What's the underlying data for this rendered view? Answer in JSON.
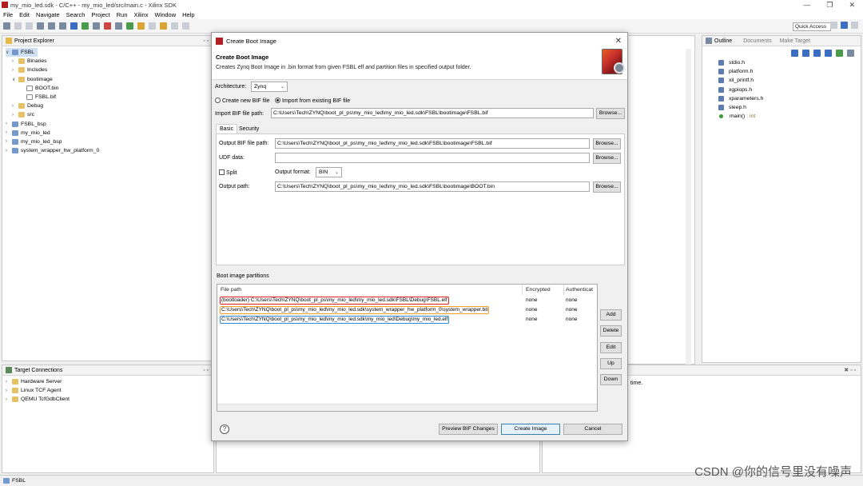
{
  "window": {
    "title": "my_mio_led.sdk - C/C++ - my_mio_led/src/main.c - Xilinx SDK"
  },
  "menu": [
    "File",
    "Edit",
    "Navigate",
    "Search",
    "Project",
    "Run",
    "Xilinx",
    "Window",
    "Help"
  ],
  "toolbar": {
    "quick_access": "Quick Access"
  },
  "project_explorer": {
    "title": "Project Explorer",
    "alt_tab": "",
    "items": [
      {
        "label": "FSBL"
      },
      {
        "label": "Binaries"
      },
      {
        "label": "Includes"
      },
      {
        "label": "bootimage"
      },
      {
        "label": "BOOT.bin"
      },
      {
        "label": "FSBL.bif"
      },
      {
        "label": "Debug"
      },
      {
        "label": "src"
      },
      {
        "label": "FSBL_bsp"
      },
      {
        "label": "my_mio_led"
      },
      {
        "label": "my_mio_led_bsp"
      },
      {
        "label": "system_wrapper_hw_platform_0"
      }
    ]
  },
  "target_connections": {
    "title": "Target Connections",
    "items": [
      {
        "label": "Hardware Server"
      },
      {
        "label": "Linux TCF Agent"
      },
      {
        "label": "QEMU TcfGdbClient"
      }
    ]
  },
  "outline": {
    "tabs": [
      "Outline",
      "Documents",
      "Make Target"
    ],
    "items": [
      "stdio.h",
      "platform.h",
      "xil_printf.h",
      "xgpiops.h",
      "xparameters.h",
      "sleep.h"
    ],
    "main_fn": "main()",
    "main_type": ": int"
  },
  "console_fragment": "time.",
  "status_bar": "FSBL",
  "watermark": "CSDN @你的信号里没有噪声",
  "dialog": {
    "window_title": "Create Boot Image",
    "header_title": "Create Boot Image",
    "header_desc": "Creates Zynq Boot Image in .bin format from given FSBL elf and partition files in specified output folder.",
    "architecture_label": "Architecture:",
    "architecture_value": "Zynq",
    "radio_new": "Create new BIF file",
    "radio_import": "Import from existing BIF file",
    "import_label": "Import BIF file path:",
    "import_value": "C:\\Users\\Tech\\ZYNQ\\boot_pl_ps\\my_mio_led\\my_mio_led.sdk\\FSBL\\bootimage\\FSBL.bif",
    "browse": "Browse...",
    "tab_basic": "Basic",
    "tab_security": "Security",
    "output_bif_label": "Output BIF file path:",
    "output_bif_value": "C:\\Users\\Tech\\ZYNQ\\boot_pl_ps\\my_mio_led\\my_mio_led.sdk\\FSBL\\bootimage\\FSBL.bif",
    "udf_label": "UDF data:",
    "udf_value": "",
    "split_label": "Split",
    "output_format_label": "Output format:",
    "output_format_value": "BIN",
    "output_path_label": "Output path:",
    "output_path_value": "C:\\Users\\Tech\\ZYNQ\\boot_pl_ps\\my_mio_led\\my_mio_led.sdk\\FSBL\\bootimage\\BOOT.bin",
    "partitions_label": "Boot image partitions",
    "columns": [
      "File path",
      "Encrypted",
      "Authenticat"
    ],
    "partitions": [
      {
        "path": "(bootloader) C:\\Users\\Tech\\ZYNQ\\boot_pl_ps\\my_mio_led\\my_mio_led.sdk\\FSBL\\Debug\\FSBL.elf",
        "encrypted": "none",
        "auth": "none",
        "color": "#e02020"
      },
      {
        "path": "C:\\Users\\Tech\\ZYNQ\\boot_pl_ps\\my_mio_led\\my_mio_led.sdk\\system_wrapper_hw_platform_0\\system_wrapper.bit",
        "encrypted": "none",
        "auth": "none",
        "color": "#f0a020"
      },
      {
        "path": "C:\\Users\\Tech\\ZYNQ\\boot_pl_ps\\my_mio_led\\my_mio_led.sdk\\my_mio_led\\Debug\\my_mio_led.elf",
        "encrypted": "none",
        "auth": "none",
        "color": "#2a8fd8"
      }
    ],
    "side_buttons": [
      "Add",
      "Delete",
      "Edit",
      "Up",
      "Down"
    ],
    "help": "?",
    "preview": "Preview BIF Changes",
    "create": "Create Image",
    "cancel": "Cancel"
  }
}
